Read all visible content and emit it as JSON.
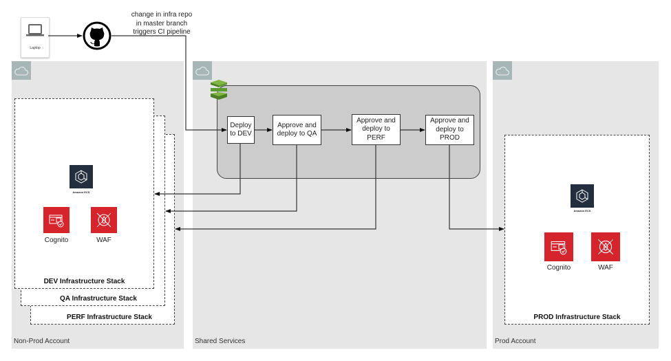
{
  "source": {
    "laptop_label": "Laptop",
    "repo_icon": "github-icon",
    "trigger_note": "change in infra repo\nin master branch\ntriggers CI pipeline"
  },
  "regions": {
    "nonprod": {
      "label": "Non-Prod Account",
      "icon": "cloud-icon"
    },
    "shared": {
      "label": "Shared Services",
      "icon": "cloud-icon"
    },
    "prod": {
      "label": "Prod Account",
      "icon": "cloud-icon"
    }
  },
  "pipeline": {
    "icon": "codepipeline-icon",
    "stages": [
      {
        "label": "Deploy\nto DEV"
      },
      {
        "label": "Approve and\ndeploy to QA"
      },
      {
        "label": "Approve and\ndeploy to\nPERF"
      },
      {
        "label": "Approve and\ndeploy to\nPROD"
      }
    ]
  },
  "stacks": {
    "dev": "DEV Infrastructure Stack",
    "qa": "QA Infrastructure Stack",
    "perf": "PERF Infrastructure Stack",
    "prod": "PROD Infrastructure Stack"
  },
  "services": {
    "ecs_label": "Amazon ECS",
    "cognito_label": "Cognito",
    "waf_label": "WAF"
  },
  "colors": {
    "region_bg": "#e6e6e6",
    "pipeline_bg": "#cccccc",
    "service_red": "#d6242d",
    "ecs_navy": "#232f3e",
    "pipeline_green": "#5a9a2f",
    "cloud_tile": "#a7b6b6"
  }
}
